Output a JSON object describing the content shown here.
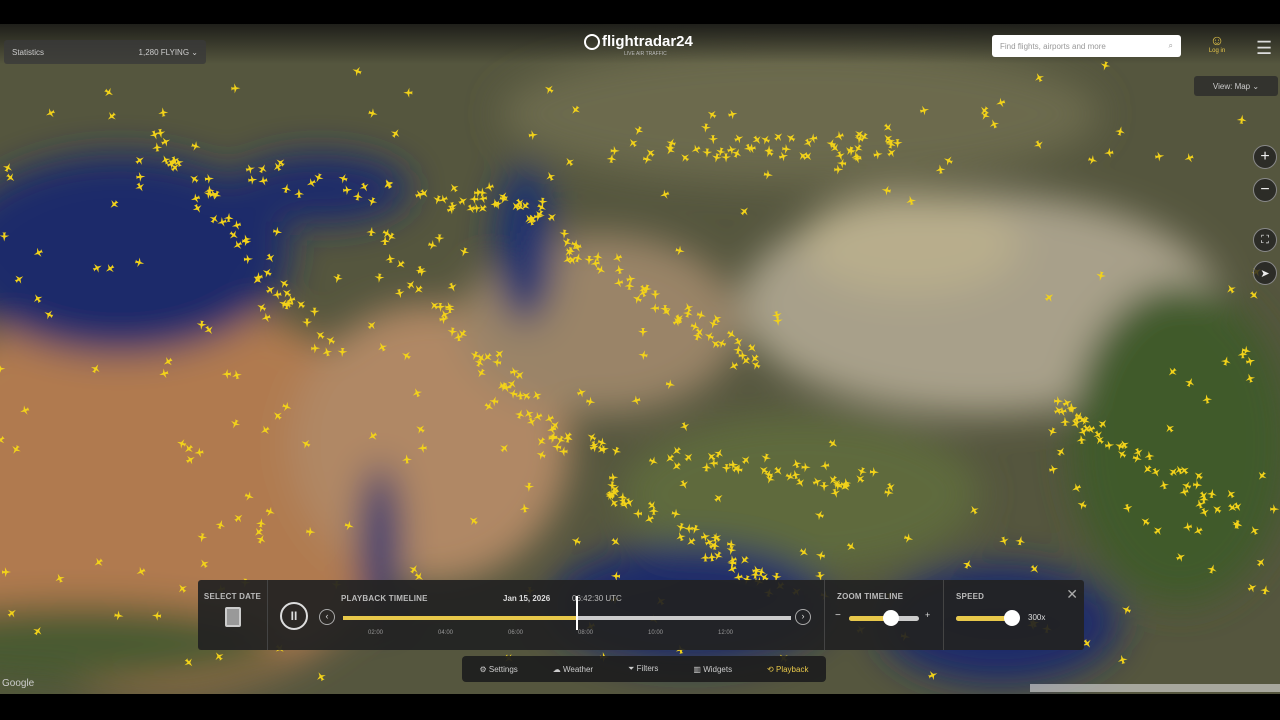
{
  "header": {
    "logo": "flightradar24",
    "logo_tagline": "LIVE AIR TRAFFIC",
    "statistics_label": "Statistics",
    "flight_count": "1,280 FLYING",
    "search_placeholder": "Find flights, airports and more",
    "login_label": "Log in",
    "view_label": "View: Map"
  },
  "map_controls": {
    "zoom_in": "+",
    "zoom_out": "−"
  },
  "playback": {
    "select_date_label": "SELECT DATE",
    "timeline_label": "PLAYBACK TIMELINE",
    "date": "Jan 15, 2026",
    "time": "06:42:30 UTC",
    "progress": 0.52,
    "ticks": [
      "02:00",
      "04:00",
      "06:00",
      "08:00",
      "10:00",
      "12:00"
    ],
    "zoom_timeline_label": "ZOOM TIMELINE",
    "zoom_level": 0.6,
    "speed_label": "SPEED",
    "speed_value": "300x",
    "speed_level": 0.9
  },
  "bottom_nav": [
    {
      "label": "Settings",
      "icon": "gear-icon"
    },
    {
      "label": "Weather",
      "icon": "weather-icon"
    },
    {
      "label": "Filters",
      "icon": "filter-icon"
    },
    {
      "label": "Widgets",
      "icon": "widgets-icon"
    },
    {
      "label": "Playback",
      "icon": "playback-icon",
      "active": true
    }
  ],
  "footer": {
    "google": "Google"
  },
  "colors": {
    "plane": "#f2d21a",
    "accent": "#e8c84a",
    "panel": "#222222"
  }
}
